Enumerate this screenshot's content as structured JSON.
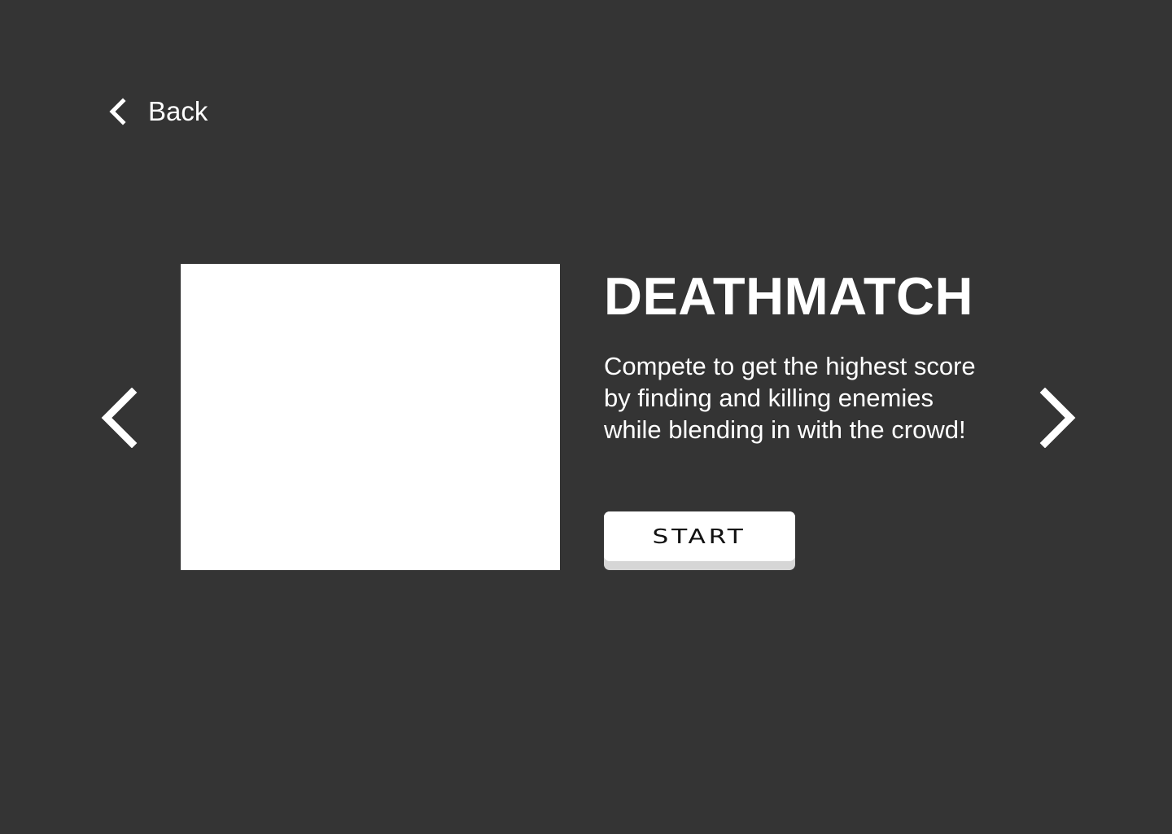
{
  "navigation": {
    "back_label": "Back",
    "back_icon": "chevron-left-icon"
  },
  "carousel": {
    "prev_icon": "chevron-left-icon",
    "next_icon": "chevron-right-icon"
  },
  "mode": {
    "title": "DEATHMATCH",
    "description": "Compete to get the highest score by finding and killing enemies while blending in with the crowd!",
    "start_label": "START"
  },
  "colors": {
    "background": "#343434",
    "text": "#ffffff",
    "button_face": "#ffffff",
    "button_shadow": "#d6d6d6",
    "button_text": "#111111"
  }
}
